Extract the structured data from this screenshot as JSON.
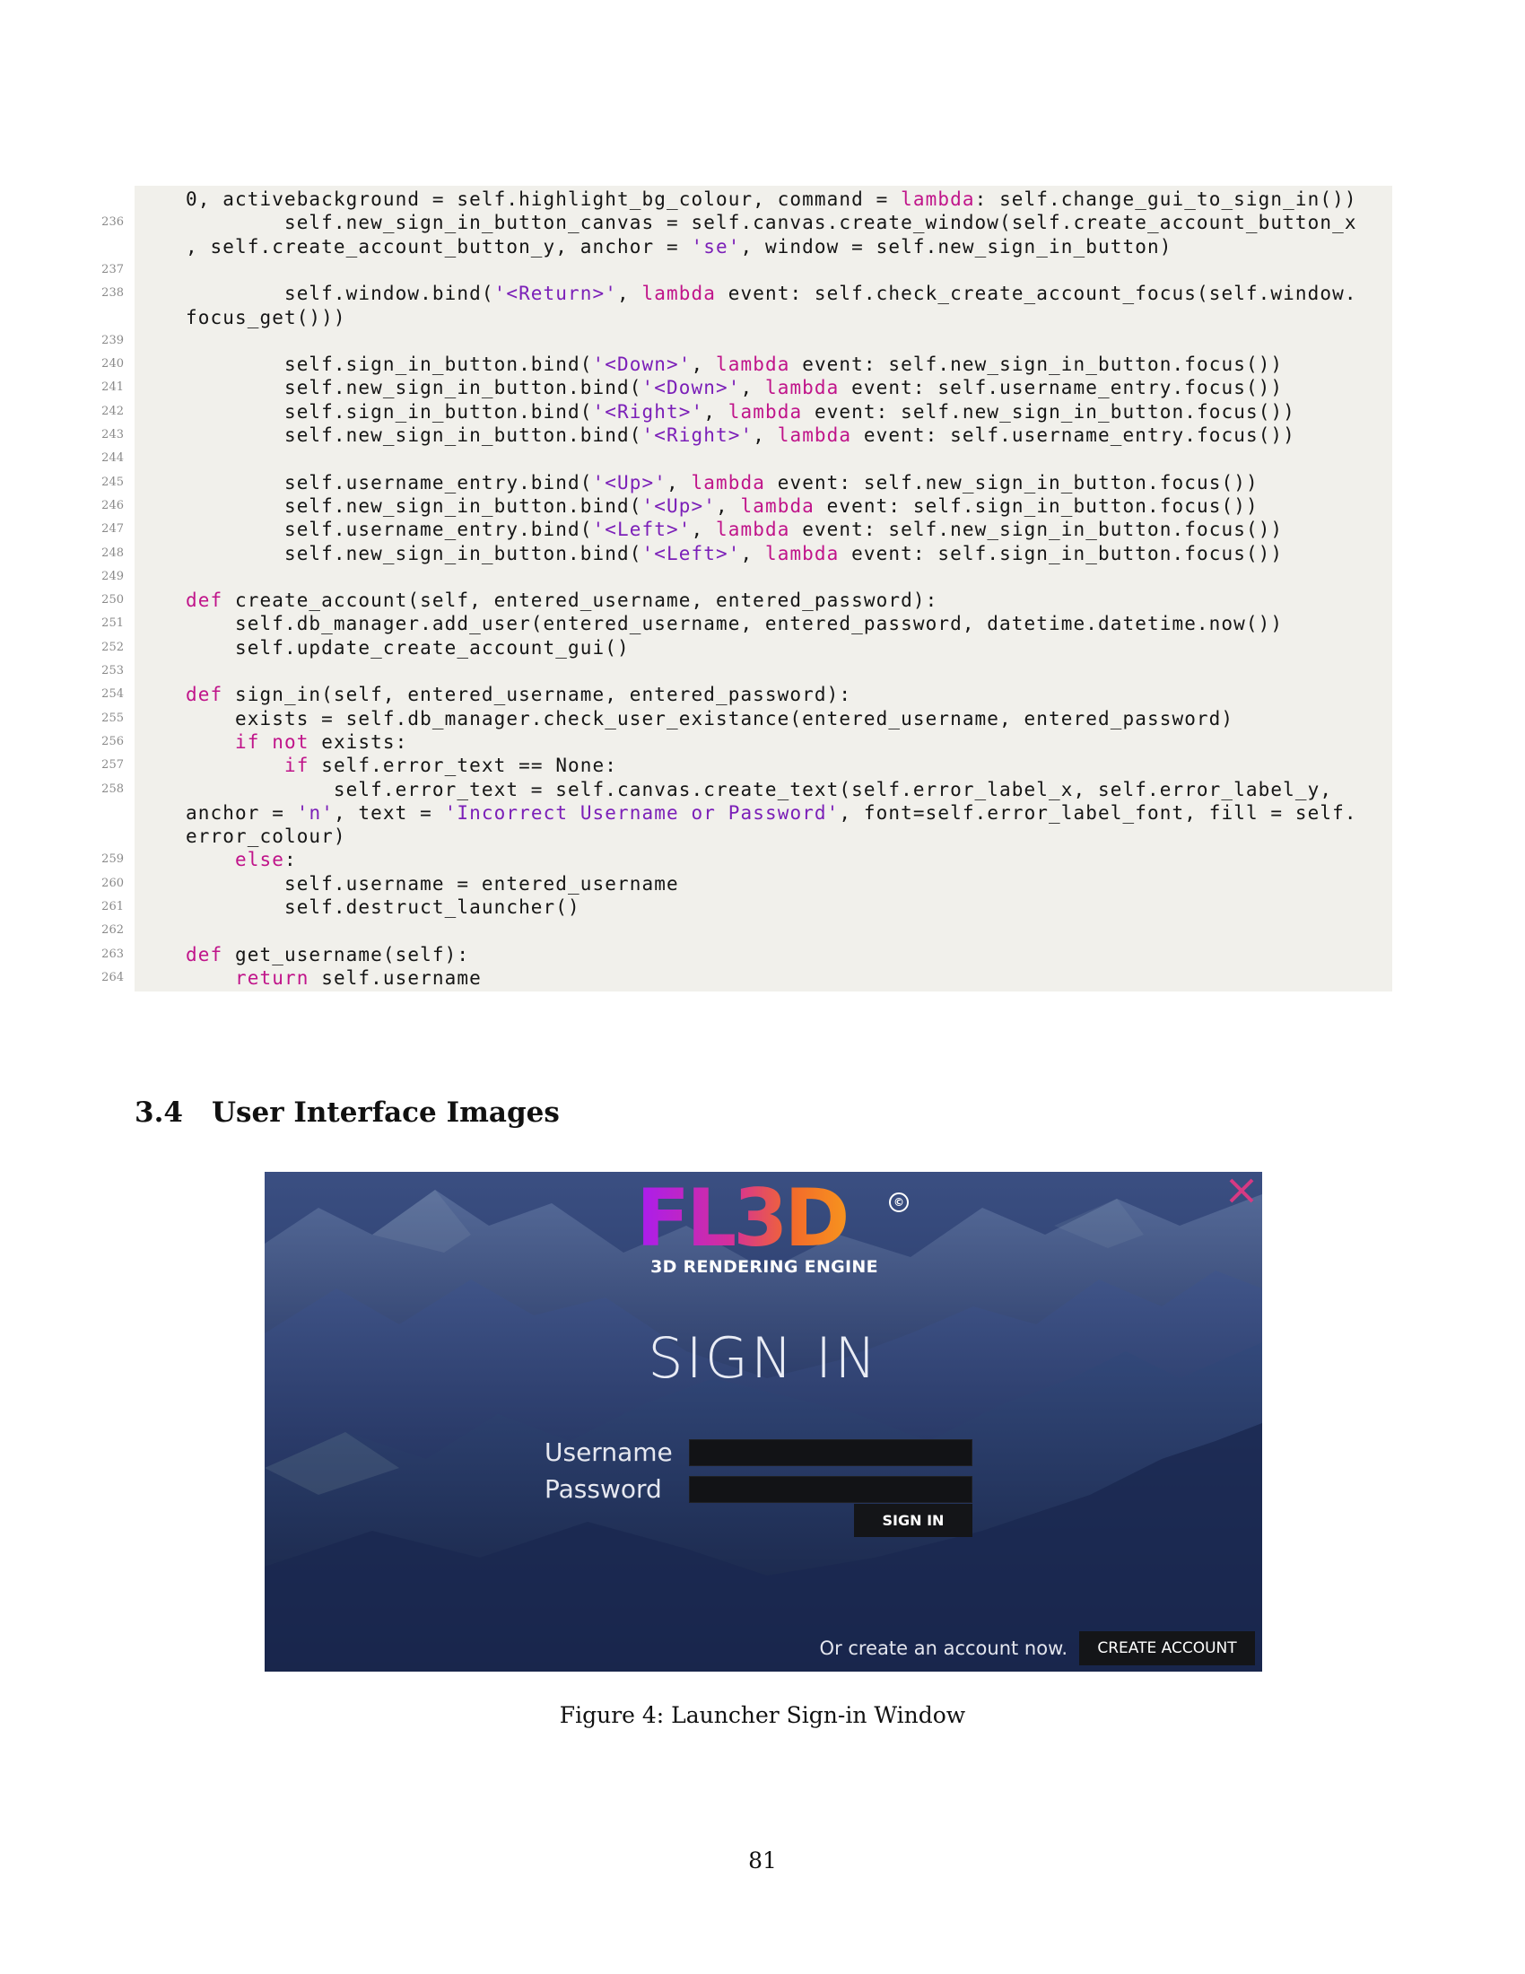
{
  "code_listing": {
    "lines": [
      {
        "no": "",
        "parts": [
          {
            "t": "0, activebackground = self.highlight_bg_colour, command = "
          },
          {
            "t": "lambda",
            "k": "kw"
          },
          {
            "t": ": self.change_gui_to_sign_in())"
          }
        ]
      },
      {
        "no": "236",
        "parts": [
          {
            "t": "        self.new_sign_in_button_canvas = self.canvas.create_window(self.create_account_button_x"
          }
        ]
      },
      {
        "no": "",
        "parts": [
          {
            "t": ", self.create_account_button_y, anchor = "
          },
          {
            "t": "'se'",
            "k": "str"
          },
          {
            "t": ", window = self.new_sign_in_button)"
          }
        ]
      },
      {
        "no": "237",
        "parts": []
      },
      {
        "no": "238",
        "parts": [
          {
            "t": "        self.window.bind("
          },
          {
            "t": "'<Return>'",
            "k": "str"
          },
          {
            "t": ", "
          },
          {
            "t": "lambda",
            "k": "kw"
          },
          {
            "t": " event: self.check_create_account_focus(self.window."
          }
        ]
      },
      {
        "no": "",
        "parts": [
          {
            "t": "focus_get()))"
          }
        ]
      },
      {
        "no": "239",
        "parts": []
      },
      {
        "no": "240",
        "parts": [
          {
            "t": "        self.sign_in_button.bind("
          },
          {
            "t": "'<Down>'",
            "k": "str"
          },
          {
            "t": ", "
          },
          {
            "t": "lambda",
            "k": "kw"
          },
          {
            "t": " event: self.new_sign_in_button.focus())"
          }
        ]
      },
      {
        "no": "241",
        "parts": [
          {
            "t": "        self.new_sign_in_button.bind("
          },
          {
            "t": "'<Down>'",
            "k": "str"
          },
          {
            "t": ", "
          },
          {
            "t": "lambda",
            "k": "kw"
          },
          {
            "t": " event: self.username_entry.focus())"
          }
        ]
      },
      {
        "no": "242",
        "parts": [
          {
            "t": "        self.sign_in_button.bind("
          },
          {
            "t": "'<Right>'",
            "k": "str"
          },
          {
            "t": ", "
          },
          {
            "t": "lambda",
            "k": "kw"
          },
          {
            "t": " event: self.new_sign_in_button.focus())"
          }
        ]
      },
      {
        "no": "243",
        "parts": [
          {
            "t": "        self.new_sign_in_button.bind("
          },
          {
            "t": "'<Right>'",
            "k": "str"
          },
          {
            "t": ", "
          },
          {
            "t": "lambda",
            "k": "kw"
          },
          {
            "t": " event: self.username_entry.focus())"
          }
        ]
      },
      {
        "no": "244",
        "parts": []
      },
      {
        "no": "245",
        "parts": [
          {
            "t": "        self.username_entry.bind("
          },
          {
            "t": "'<Up>'",
            "k": "str"
          },
          {
            "t": ", "
          },
          {
            "t": "lambda",
            "k": "kw"
          },
          {
            "t": " event: self.new_sign_in_button.focus())"
          }
        ]
      },
      {
        "no": "246",
        "parts": [
          {
            "t": "        self.new_sign_in_button.bind("
          },
          {
            "t": "'<Up>'",
            "k": "str"
          },
          {
            "t": ", "
          },
          {
            "t": "lambda",
            "k": "kw"
          },
          {
            "t": " event: self.sign_in_button.focus())"
          }
        ]
      },
      {
        "no": "247",
        "parts": [
          {
            "t": "        self.username_entry.bind("
          },
          {
            "t": "'<Left>'",
            "k": "str"
          },
          {
            "t": ", "
          },
          {
            "t": "lambda",
            "k": "kw"
          },
          {
            "t": " event: self.new_sign_in_button.focus())"
          }
        ]
      },
      {
        "no": "248",
        "parts": [
          {
            "t": "        self.new_sign_in_button.bind("
          },
          {
            "t": "'<Left>'",
            "k": "str"
          },
          {
            "t": ", "
          },
          {
            "t": "lambda",
            "k": "kw"
          },
          {
            "t": " event: self.sign_in_button.focus())"
          }
        ]
      },
      {
        "no": "249",
        "parts": []
      },
      {
        "no": "250",
        "parts": [
          {
            "t": "def",
            "k": "kw"
          },
          {
            "t": " create_account(self, entered_username, entered_password):"
          }
        ]
      },
      {
        "no": "251",
        "parts": [
          {
            "t": "    self.db_manager.add_user(entered_username, entered_password, datetime.datetime.now())"
          }
        ]
      },
      {
        "no": "252",
        "parts": [
          {
            "t": "    self.update_create_account_gui()"
          }
        ]
      },
      {
        "no": "253",
        "parts": []
      },
      {
        "no": "254",
        "parts": [
          {
            "t": "def",
            "k": "kw"
          },
          {
            "t": " sign_in(self, entered_username, entered_password):"
          }
        ]
      },
      {
        "no": "255",
        "parts": [
          {
            "t": "    exists = self.db_manager.check_user_existance(entered_username, entered_password)"
          }
        ]
      },
      {
        "no": "256",
        "parts": [
          {
            "t": "    "
          },
          {
            "t": "if not",
            "k": "kw"
          },
          {
            "t": " exists:"
          }
        ]
      },
      {
        "no": "257",
        "parts": [
          {
            "t": "        "
          },
          {
            "t": "if",
            "k": "kw"
          },
          {
            "t": " self.error_text == None:"
          }
        ]
      },
      {
        "no": "258",
        "parts": [
          {
            "t": "            self.error_text = self.canvas.create_text(self.error_label_x, self.error_label_y,"
          }
        ]
      },
      {
        "no": "",
        "parts": [
          {
            "t": "anchor = "
          },
          {
            "t": "'n'",
            "k": "str"
          },
          {
            "t": ", text = "
          },
          {
            "t": "'Incorrect Username or Password'",
            "k": "str"
          },
          {
            "t": ", font=self.error_label_font, fill = self."
          }
        ]
      },
      {
        "no": "",
        "parts": [
          {
            "t": "error_colour)"
          }
        ]
      },
      {
        "no": "259",
        "parts": [
          {
            "t": "    "
          },
          {
            "t": "else",
            "k": "kw"
          },
          {
            "t": ":"
          }
        ]
      },
      {
        "no": "260",
        "parts": [
          {
            "t": "        self.username = entered_username"
          }
        ]
      },
      {
        "no": "261",
        "parts": [
          {
            "t": "        self.destruct_launcher()"
          }
        ]
      },
      {
        "no": "262",
        "parts": []
      },
      {
        "no": "263",
        "parts": [
          {
            "t": "def",
            "k": "kw"
          },
          {
            "t": " get_username(self):"
          }
        ]
      },
      {
        "no": "264",
        "parts": [
          {
            "t": "    "
          },
          {
            "t": "return",
            "k": "kw"
          },
          {
            "t": " self.username"
          }
        ]
      }
    ]
  },
  "section": {
    "number": "3.4",
    "title": "User Interface Images"
  },
  "launcher": {
    "logo_text": "FL3D",
    "copyright_symbol": "©",
    "subtitle": "3D RENDERING ENGINE",
    "title": "SIGN IN",
    "username_label": "Username",
    "password_label": "Password",
    "username_value": "",
    "password_value": "",
    "sign_in_button": "SIGN IN",
    "create_prompt": "Or create an account now.",
    "create_account_button": "CREATE ACCOUNT",
    "close_icon": "close-icon",
    "colors": {
      "close": "#d63a83",
      "logo_start": "#a91cf0",
      "logo_end": "#f7931e"
    }
  },
  "figure_caption": "Figure 4: Launcher Sign-in Window",
  "page_number": "81"
}
